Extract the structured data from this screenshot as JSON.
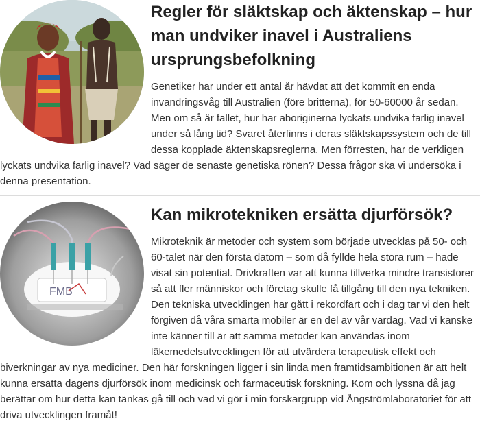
{
  "articles": [
    {
      "title": "Regler för släktskap och äktenskap – hur man undviker inavel i Australiens ursprungsbefolkning",
      "body": "Genetiker har under ett antal år hävdat att det kommit en enda invandringsvåg till Australien (före britterna), för 50-60000 år sedan. Men om så är fallet, hur har aboriginerna lyckats undvika farlig inavel under så lång tid? Svaret återfinns i deras släktskapssystem och de till dessa kopplade äktenskapsreglerna. Men förresten, har de verkligen lyckats undvika farlig inavel? Vad säger de senaste genetiska rönen? Dessa frågor ska vi undersöka i denna presentation.",
      "image": "people-photo"
    },
    {
      "title": "Kan mikrotekniken ersätta djurförsök?",
      "body": "Mikroteknik är metoder och system som började utvecklas på 50- och 60-talet när den första datorn – som då fyllde hela stora rum – hade visat sin potential. Drivkraften var att kunna tillverka mindre transistorer så att fler människor och företag skulle få tillgång till den nya tekniken. Den tekniska utvecklingen har gått i rekordfart och i dag tar vi den helt förgiven då våra smarta mobiler är en del av vår vardag. Vad vi kanske inte känner till är att samma metoder kan användas inom läkemedelsutvecklingen för att utvärdera terapeutisk effekt och biverkningar av nya mediciner. Den här forskningen ligger i sin linda men framtidsambitionen är att helt kunna ersätta dagens djurförsök inom medicinsk och farmaceutisk forskning. Kom och lyssna då jag berättar om hur detta kan tänkas gå till och vad vi gör i min forskargrupp vid Ångströmlaboratoriet för att driva utvecklingen framåt!",
      "image": "microchip-photo",
      "chip_text": "FMB"
    }
  ]
}
